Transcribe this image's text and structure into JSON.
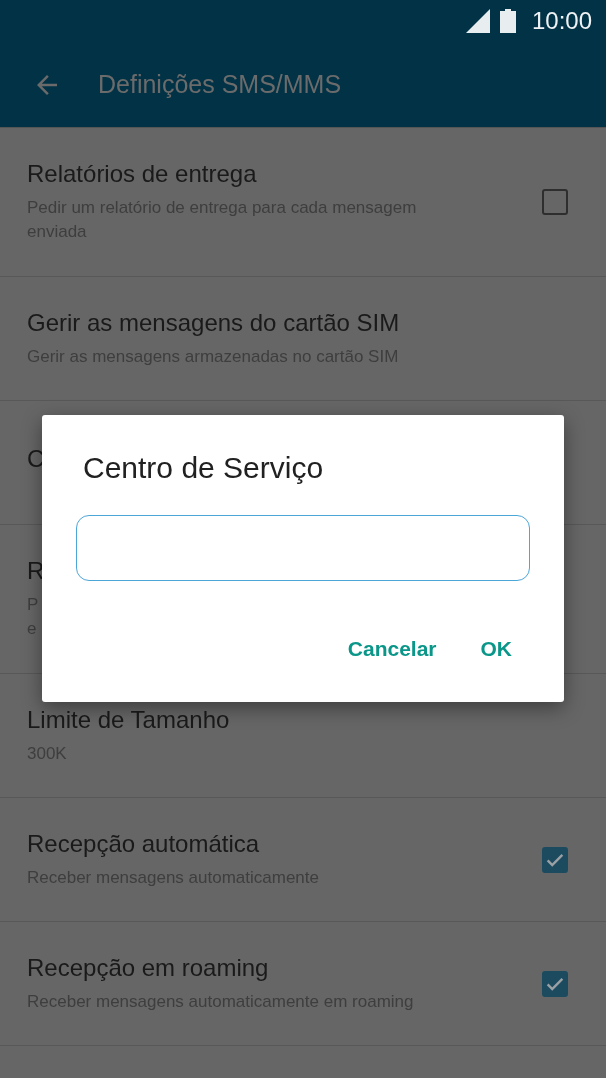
{
  "status_bar": {
    "time": "10:00"
  },
  "app_bar": {
    "title": "Definições SMS/MMS"
  },
  "settings": [
    {
      "title": "Relatórios de entrega",
      "subtitle": [
        "Pedir um relatório de entrega para cada mensagem",
        "enviada"
      ],
      "kind": "checkbox",
      "checked": false
    },
    {
      "title": "Gerir as mensagens do cartão SIM",
      "subtitle": [
        "Gerir as mensagens armazenadas no cartão SIM"
      ],
      "kind": "plain"
    },
    {
      "title": "C",
      "kind": "plain"
    },
    {
      "title": "R",
      "subtitle": [
        "P",
        "e"
      ],
      "kind": "plain"
    },
    {
      "title": "Limite de Tamanho",
      "subtitle": [
        "300K"
      ],
      "kind": "plain"
    },
    {
      "title": "Recepção automática",
      "subtitle": [
        "Receber mensagens automaticamente"
      ],
      "kind": "checkbox",
      "checked": true
    },
    {
      "title": "Recepção em roaming",
      "subtitle": [
        "Receber mensagens automaticamente em roaming"
      ],
      "kind": "checkbox",
      "checked": true
    }
  ],
  "dialog": {
    "title": "Centro de Serviço",
    "buttons": [
      "Cancelar",
      "OK"
    ]
  }
}
